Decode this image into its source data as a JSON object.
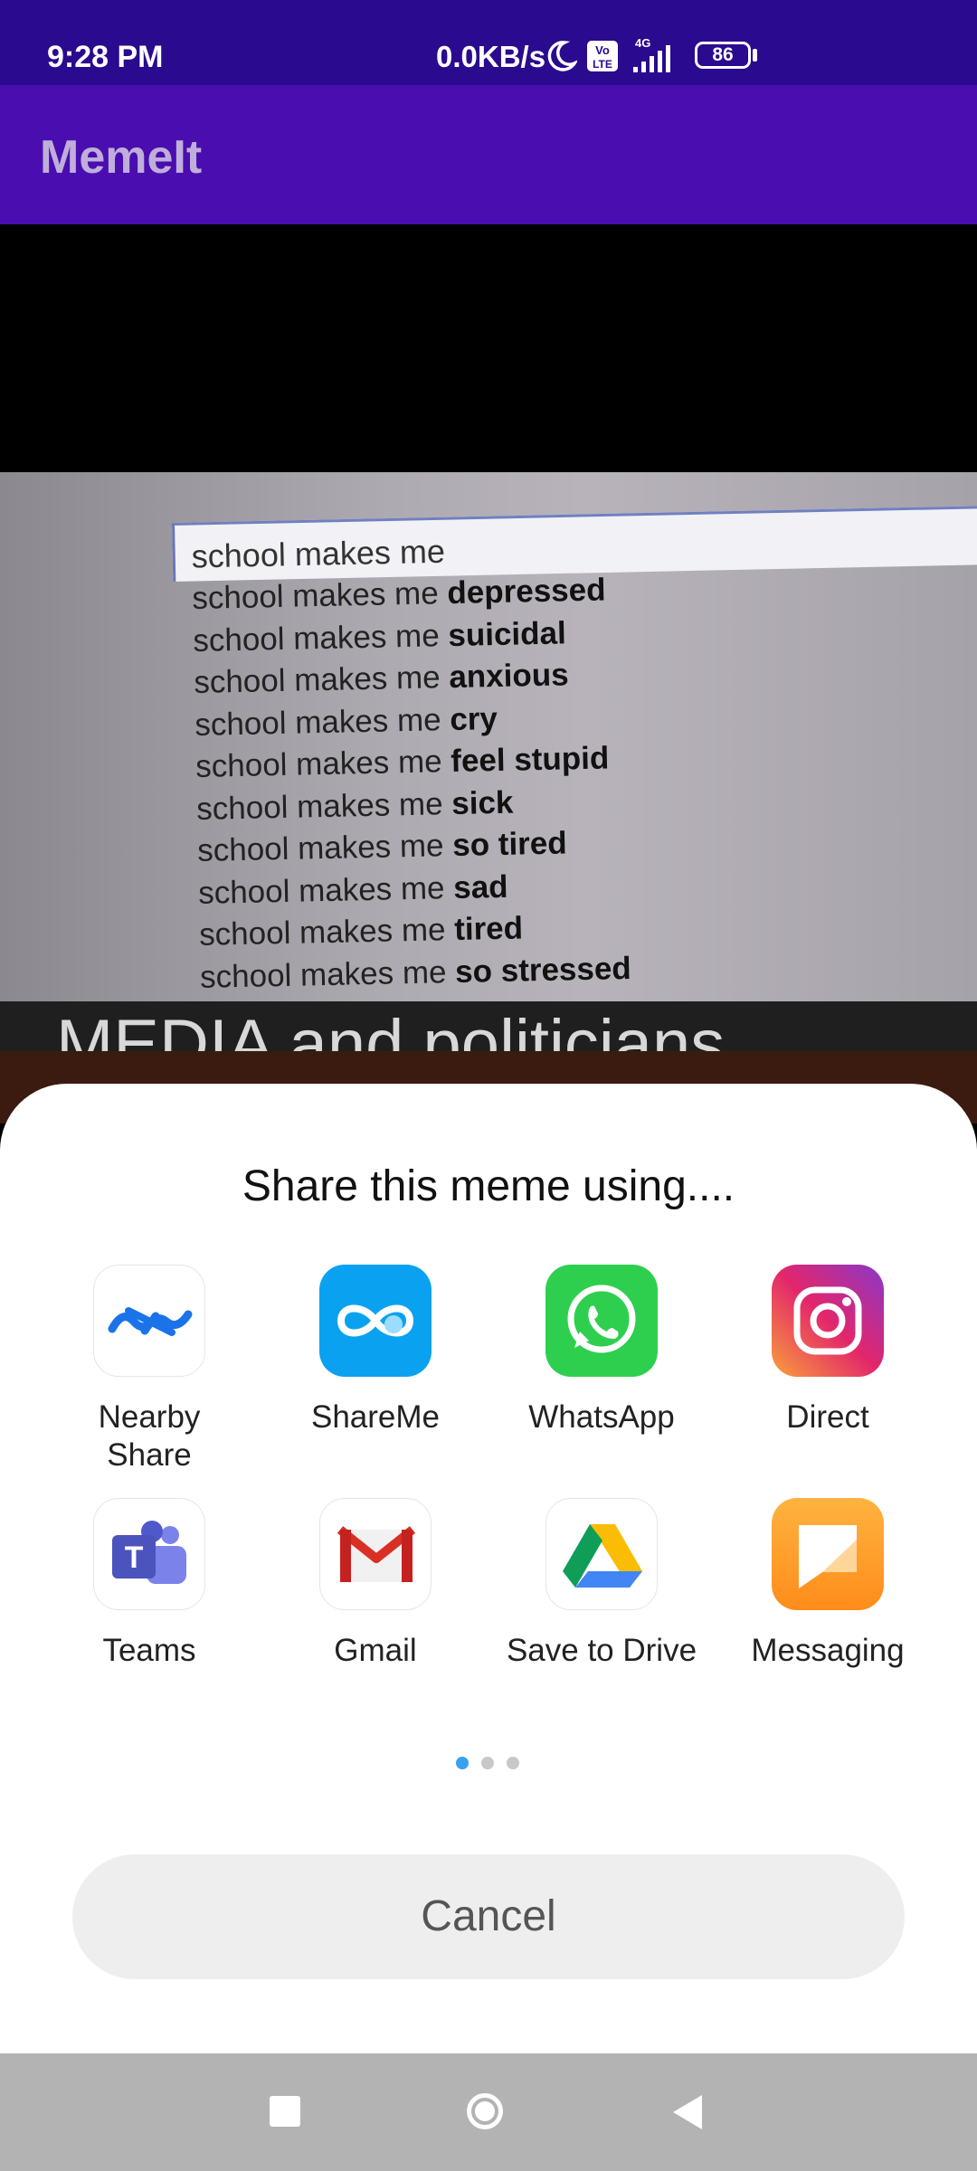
{
  "status_bar": {
    "time": "9:28 PM",
    "network_speed": "0.0KB/s",
    "volte_label": "Vo LTE",
    "signal_type": "4G",
    "battery": "86",
    "icons": [
      "moon-icon",
      "volte-icon",
      "signal-icon",
      "battery-icon"
    ]
  },
  "app_bar": {
    "title": "MemeIt",
    "background": "#4a0db0"
  },
  "meme": {
    "search_query": "school makes me",
    "suggestions": [
      {
        "prefix": "school makes me ",
        "bold": "depressed"
      },
      {
        "prefix": "school makes me ",
        "bold": "suicidal"
      },
      {
        "prefix": "school makes me ",
        "bold": "anxious"
      },
      {
        "prefix": "school makes me ",
        "bold": "cry"
      },
      {
        "prefix": "school makes me ",
        "bold": "feel stupid"
      },
      {
        "prefix": "school makes me ",
        "bold": "sick"
      },
      {
        "prefix": "school makes me ",
        "bold": "so tired"
      },
      {
        "prefix": "school makes me ",
        "bold": "sad"
      },
      {
        "prefix": "school makes me ",
        "bold": "tired"
      },
      {
        "prefix": "school makes me ",
        "bold": "so stressed"
      }
    ],
    "caption": "MEDIA and politicians"
  },
  "share_sheet": {
    "title": "Share this meme using....",
    "apps": [
      {
        "label": "Nearby\nShare",
        "icon": "nearby-share-icon"
      },
      {
        "label": "ShareMe",
        "icon": "shareme-icon"
      },
      {
        "label": "WhatsApp",
        "icon": "whatsapp-icon"
      },
      {
        "label": "Direct",
        "icon": "instagram-direct-icon"
      },
      {
        "label": "Teams",
        "icon": "teams-icon"
      },
      {
        "label": "Gmail",
        "icon": "gmail-icon"
      },
      {
        "label": "Save to Drive",
        "icon": "google-drive-icon"
      },
      {
        "label": "Messaging",
        "icon": "messaging-icon"
      }
    ],
    "page_indicator": {
      "total": 3,
      "active": 0,
      "active_color": "#3aa0f0"
    },
    "cancel_label": "Cancel"
  },
  "nav_bar": {
    "buttons": [
      "recents-square-icon",
      "home-circle-icon",
      "back-triangle-icon"
    ]
  }
}
